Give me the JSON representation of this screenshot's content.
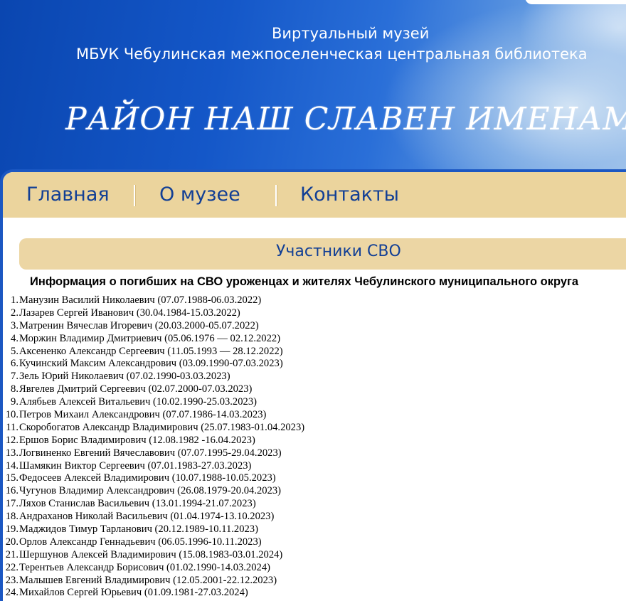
{
  "header": {
    "museum_label": "Виртуальный музей",
    "library_label": "МБУК Чебулинская межпоселенческая центральная библиотека",
    "site_title": "РАЙОН НАШ СЛАВЕН ИМЕНАМИ"
  },
  "nav": {
    "items": [
      {
        "label": "Главная"
      },
      {
        "label": "О музее"
      },
      {
        "label": "Контакты"
      }
    ]
  },
  "section": {
    "title": "Участники СВО",
    "heading": "Информация о погибших на СВО уроженцах и жителях Чебулинского муниципального округа"
  },
  "list": [
    {
      "num": "1.",
      "text": "Манузин Василий Николаевич (07.07.1988-06.03.2022)"
    },
    {
      "num": "2.",
      "text": "Лазарев Сергей Иванович (30.04.1984-15.03.2022)"
    },
    {
      "num": "3.",
      "text": "Матренин Вячеслав Игоревич (20.03.2000-05.07.2022)"
    },
    {
      "num": "4.",
      "text": "Моржин Владимир Дмитриевич (05.06.1976 — 02.12.2022)"
    },
    {
      "num": "5.",
      "text": "Аксененко Александр Сергеевич (11.05.1993 — 28.12.2022)"
    },
    {
      "num": "6.",
      "text": "Кучинский Максим Александрович (03.09.1990-07.03.2023)"
    },
    {
      "num": "7.",
      "text": "Зель Юрий Николаевич (07.02.1990-03.03.2023)"
    },
    {
      "num": "8.",
      "text": "Явгелев Дмитрий Сергеевич (02.07.2000-07.03.2023)"
    },
    {
      "num": "9.",
      "text": "Алябьев Алексей Витальевич (10.02.1990-25.03.2023)"
    },
    {
      "num": "10.",
      "text": "Петров Михаил Александрович (07.07.1986-14.03.2023)"
    },
    {
      "num": "11.",
      "text": "Скоробогатов Александр Владимирович (25.07.1983-01.04.2023)"
    },
    {
      "num": "12.",
      "text": "Ершов Борис Владимирович (12.08.1982 -16.04.2023)"
    },
    {
      "num": "13.",
      "text": "Логвиненко Евгений Вячеславович (07.07.1995-29.04.2023)"
    },
    {
      "num": "14.",
      "text": "Шамякин Виктор Сергеевич (07.01.1983-27.03.2023)"
    },
    {
      "num": "15.",
      "text": "Федосеев Алексей Владимирович (10.07.1988-10.05.2023)"
    },
    {
      "num": "16.",
      "text": "Чугунов Владимир Александрович (26.08.1979-20.04.2023)"
    },
    {
      "num": "17.",
      "text": "Ляхов Станислав Васильевич (13.01.1994-21.07.2023)"
    },
    {
      "num": "18.",
      "text": "Андраханов Николай Васильевич (01.04.1974-13.10.2023)"
    },
    {
      "num": "19.",
      "text": "Маджидов Тимур Тарланович (20.12.1989-10.11.2023)"
    },
    {
      "num": "20.",
      "text": "Орлов Александр Геннадьевич (06.05.1996-10.11.2023)"
    },
    {
      "num": "21.",
      "text": "Шершунов Алексей Владимирович (15.08.1983-03.01.2024)"
    },
    {
      "num": "22.",
      "text": "Терентьев Александр Борисович (01.02.1990-14.03.2024)"
    },
    {
      "num": "23.",
      "text": "Малышев Евгений Владимирович (12.05.2001-22.12.2023)"
    },
    {
      "num": "24.",
      "text": "Михайлов Сергей Юрьевич (01.09.1981-27.03.2024)"
    }
  ]
}
